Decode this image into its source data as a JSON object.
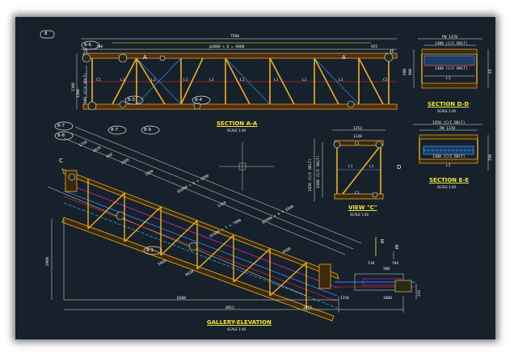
{
  "drawing": {
    "page_mark": "8",
    "section_aa": {
      "title": "SECTION A-A",
      "scale": "SCALE 1:40",
      "overall": "7580",
      "pitch": "@1000 × 6 = 6000",
      "left_gap": "790",
      "right_gap": "925",
      "end_dims": [
        "75",
        "45",
        "45",
        "65"
      ],
      "height_dims": [
        "1100",
        "900 (C/C BOLT)",
        "1300"
      ],
      "members": [
        "C1",
        "C1",
        "L1",
        "L1",
        "L1",
        "L1",
        "L1",
        "L1",
        "L1",
        "L1",
        "C1"
      ]
    },
    "section_dd": {
      "title": "SECTION D-D",
      "scale": "SCALE 1:40",
      "dims": [
        "PW 1370",
        "1300 (C/C BOLT)",
        "1300 (C/C BOLT)",
        "L1"
      ],
      "side_dims": [
        "600",
        "900",
        "65"
      ]
    },
    "section_ee": {
      "title": "SECTION E-E",
      "scale": "SCALE 1:40",
      "dims": [
        "1450 (C/C BOLT)",
        "PW 1370",
        "1300 (C/C BOLT)",
        "L1"
      ],
      "side_dims": [
        "45",
        "600",
        "250"
      ]
    },
    "view_c": {
      "title": "VIEW \"C\"",
      "scale": "SCALE 1:40",
      "dims": [
        "1253",
        "1120",
        "C1",
        "L1",
        "L1",
        "C1"
      ],
      "side_dims": [
        "1450 (C/C BOLT)",
        "1300 (C/C BOLT)",
        "900",
        "45"
      ]
    },
    "gallery": {
      "title": "GALLERY-ELEVATION",
      "scale": "SCALE 1:40",
      "bottom_dims": [
        "6580",
        "8912",
        "1012",
        "1250",
        "1000",
        "235"
      ],
      "slope_dims": [
        "1760",
        "1020",
        "445",
        "940",
        "1000",
        "8620",
        "1800",
        "5360",
        "6920",
        "@1000 × 5 = 5000",
        "@1000 × 6 = 6000",
        "@1000 × 7 = 7000",
        "7870",
        "4600",
        "2660",
        "5000",
        "6830"
      ],
      "right_dims": [
        "510",
        "784",
        "390",
        "60",
        "42",
        "75",
        "2295"
      ],
      "side_dim": "2960"
    },
    "tags": [
      "8-6",
      "8-1",
      "8-7",
      "8-8",
      "8-9",
      "8-7",
      "8-4",
      "8-3",
      "8-2",
      "8-1"
    ],
    "section_marks": [
      "A",
      "A",
      "E",
      "E",
      "D",
      "D",
      "C"
    ]
  }
}
